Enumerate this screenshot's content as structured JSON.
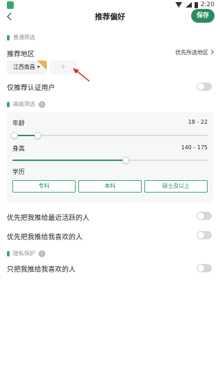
{
  "status_bar": {
    "time": "2:20"
  },
  "header": {
    "title": "推荐偏好",
    "save_label": "保存"
  },
  "general_section": {
    "tag": "普通筛选",
    "region": {
      "label": "推荐地区",
      "link_label": "优先所选地区",
      "chip_value": "江西南昌",
      "add_symbol": "+"
    },
    "certified_only": {
      "label": "仅推荐认证用户",
      "enabled": false
    }
  },
  "advanced_section": {
    "tag": "高级筛选",
    "info_symbol": "!",
    "age": {
      "label": "年龄",
      "range_text": "18 - 22",
      "min": 18,
      "max": 22,
      "fill_fraction": 0.13
    },
    "height": {
      "label": "身高",
      "range_text": "140 - 175",
      "fill_fraction": 0.58
    },
    "education": {
      "label": "学历",
      "options": [
        "专科",
        "本科",
        "硕士及以上"
      ]
    }
  },
  "preferences": {
    "recently_active": {
      "label": "优先把我推给最近活跃的人",
      "enabled": false
    },
    "liked_me": {
      "label": "优先把我推给我喜欢的人",
      "enabled": false
    }
  },
  "privacy_section": {
    "tag": "隐私保护",
    "info_symbol": "!",
    "only_liked": {
      "label": "只把我推给我喜欢的人",
      "enabled": false
    }
  },
  "colors": {
    "accent": "#2b8a61",
    "accent_light": "#3aa76d",
    "chip_corner": "#e9b25c",
    "annotation_arrow": "#d42a2a"
  }
}
